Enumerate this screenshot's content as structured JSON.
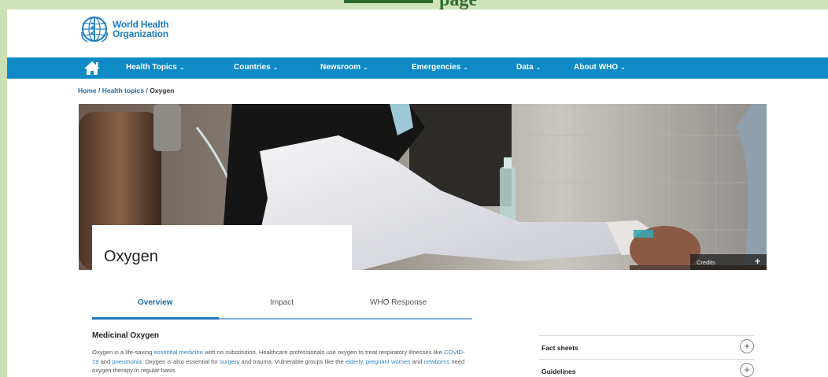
{
  "slide": {
    "title_fragment": "page"
  },
  "brand": {
    "line1": "World Health",
    "line2": "Organization"
  },
  "nav": {
    "items": [
      {
        "label": "Health Topics"
      },
      {
        "label": "Countries"
      },
      {
        "label": "Newsroom"
      },
      {
        "label": "Emergencies"
      },
      {
        "label": "Data"
      },
      {
        "label": "About WHO"
      }
    ],
    "chevron": "⌄"
  },
  "breadcrumb": {
    "home": "Home",
    "sep1": " / ",
    "topics": "Health topics",
    "sep2": " / ",
    "current": "Oxygen"
  },
  "hero": {
    "title": "Oxygen",
    "credits_label": "Credits",
    "credits_icon": "+"
  },
  "tabs": [
    {
      "label": "Overview",
      "active": true
    },
    {
      "label": "Impact",
      "active": false
    },
    {
      "label": "WHO Response",
      "active": false
    }
  ],
  "content": {
    "heading": "Medicinal Oxygen",
    "p1": "Oxygen is a life-saving ",
    "link_essential": "essential medicine",
    "p2": " with no substitution. Healthcare professionals use oxygen to treat respiratory illnesses like  ",
    "link_covid": "COVID-19",
    "p3": " and ",
    "link_pneumonia": "pneumonia",
    "p4": ". Oxygen is also essential for ",
    "link_surgery": "surgery",
    "p5": " and trauma. Vulnerable groups like the ",
    "link_elderly": "elderly",
    "p6": ", ",
    "link_pregnant": "pregnant women",
    "p7": " and ",
    "link_newborns": "newborns",
    "p8": " need oxygen therapy in regular basis."
  },
  "sidebar": {
    "items": [
      {
        "label": "Fact sheets",
        "icon": "+"
      },
      {
        "label": "Guidelines",
        "icon": "+"
      }
    ]
  },
  "colors": {
    "nav": "#0e8ac7",
    "link": "#2a86c6",
    "brand": "#1f7cc0",
    "frame": "#c9dfb4"
  }
}
